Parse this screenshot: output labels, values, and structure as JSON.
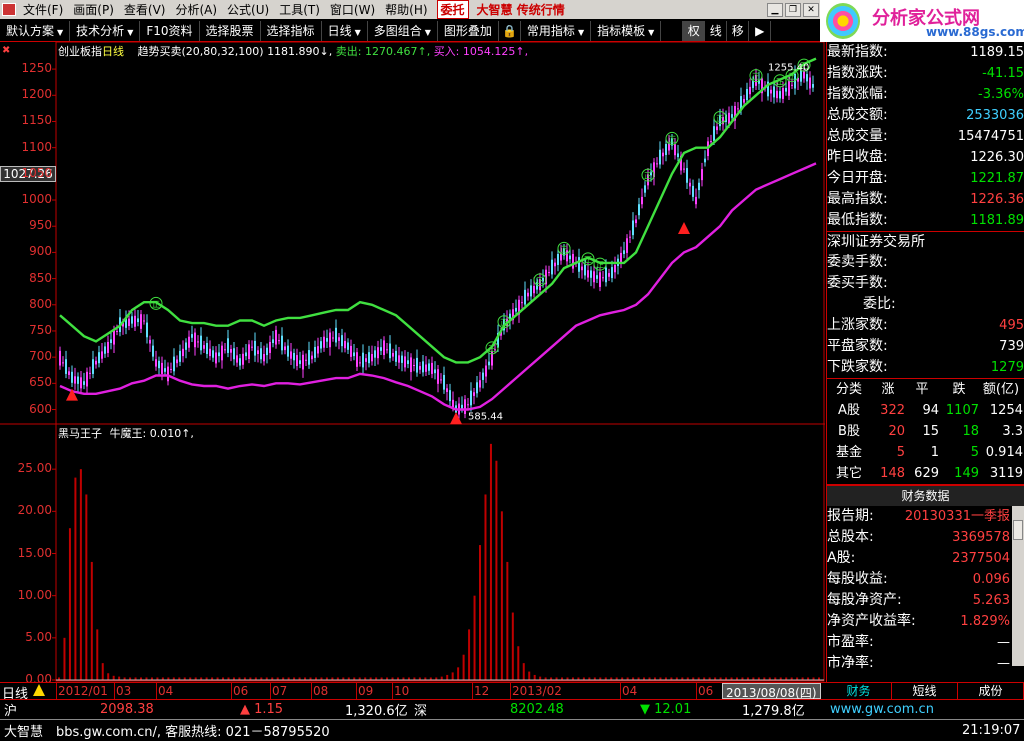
{
  "menu": {
    "items": [
      "文件(F)",
      "画面(P)",
      "查看(V)",
      "分析(A)",
      "公式(U)",
      "工具(T)",
      "窗口(W)",
      "帮助(H)"
    ],
    "trade_button": "委托",
    "brand": "大智慧 传统行情"
  },
  "logo": {
    "title": "分析家公式网",
    "url": "www.88gs.com"
  },
  "toolbar": {
    "items": [
      "默认方案",
      "技术分析",
      "F10资料",
      "选择股票",
      "选择指标",
      "日线",
      "多图组合",
      "图形叠加",
      "常用指标",
      "指标模板"
    ],
    "buttons": [
      "权",
      "线",
      "移"
    ]
  },
  "chart": {
    "title": "创业板指",
    "period_label": "日线",
    "indicator_name": "趋势买卖(20,80,32,100)",
    "indicator_value": "1181.890↓,",
    "sell_label": "卖出:",
    "sell_value": "1270.467↑,",
    "buy_label": "买入:",
    "buy_value": "1054.125↑,",
    "current_price": "1027.26",
    "high_annotation": "1255.40",
    "low_annotation": "585.44",
    "sub_indicator_name": "黑马王子",
    "sub_line": "牛魔王: 0.010↑,",
    "colors": {
      "upper": "#40e040",
      "lower": "#e020e0",
      "up_candle": "#ff40ff",
      "down_candle": "#60e0ff",
      "volume": "#c00000"
    }
  },
  "chart_data": [
    {
      "type": "line",
      "title": "创业板指",
      "y_ticks": [
        600,
        650,
        700,
        750,
        800,
        850,
        900,
        950,
        1000,
        1050,
        1100,
        1150,
        1200,
        1250
      ],
      "ylim": [
        580,
        1275
      ],
      "x_labels": [
        "2012/01",
        "03",
        "04",
        "06",
        "07",
        "08",
        "09",
        "10",
        "12",
        "2013/02",
        "04",
        "06"
      ],
      "series": [
        {
          "name": "卖出",
          "values": [
            780,
            760,
            740,
            730,
            745,
            760,
            790,
            805,
            805,
            790,
            770,
            765,
            765,
            760,
            760,
            770,
            770,
            760,
            770,
            775,
            775,
            780,
            785,
            790,
            790,
            805,
            800,
            790,
            780,
            760,
            740,
            720,
            700,
            690,
            690,
            700,
            720,
            760,
            780,
            800,
            820,
            840,
            870,
            880,
            890,
            880,
            880,
            880,
            900,
            950,
            1000,
            1050,
            1090,
            1100,
            1100,
            1120,
            1150,
            1180,
            1200,
            1220,
            1230,
            1240,
            1260,
            1270
          ]
        },
        {
          "name": "买入",
          "values": [
            645,
            635,
            630,
            630,
            635,
            640,
            650,
            655,
            665,
            665,
            655,
            648,
            645,
            645,
            640,
            645,
            648,
            645,
            650,
            650,
            648,
            652,
            656,
            660,
            660,
            668,
            665,
            660,
            652,
            645,
            635,
            625,
            610,
            600,
            600,
            605,
            620,
            640,
            660,
            680,
            700,
            720,
            740,
            760,
            770,
            780,
            785,
            790,
            800,
            820,
            850,
            880,
            900,
            910,
            930,
            950,
            980,
            1000,
            1020,
            1030,
            1040,
            1050,
            1060,
            1070
          ]
        },
        {
          "name": "收盘",
          "values": [
            700,
            660,
            650,
            690,
            720,
            760,
            770,
            770,
            690,
            670,
            700,
            740,
            720,
            700,
            720,
            690,
            720,
            700,
            740,
            710,
            690,
            700,
            730,
            740,
            720,
            690,
            700,
            720,
            700,
            690,
            680,
            680,
            650,
            600,
            610,
            650,
            700,
            760,
            790,
            820,
            840,
            870,
            900,
            880,
            860,
            850,
            860,
            900,
            960,
            1040,
            1080,
            1110,
            1060,
            1000,
            1100,
            1150,
            1160,
            1190,
            1230,
            1210,
            1200,
            1220,
            1240,
            1210
          ]
        }
      ]
    },
    {
      "type": "bar",
      "title": "黑马王子",
      "y_ticks": [
        0.0,
        5.0,
        10.0,
        15.0,
        20.0,
        25.0
      ],
      "ylim": [
        0,
        30
      ],
      "series": [
        {
          "values": [
            0.3,
            5,
            18,
            24,
            25,
            22,
            14,
            6,
            2,
            0.8,
            0.5,
            0.4,
            0.3,
            0.3,
            0.3,
            0.3,
            0.3,
            0.3,
            0.3,
            0.3,
            0.3,
            0.3,
            0.3,
            0.3,
            0.3,
            0.3,
            0.3,
            0.3,
            0.3,
            0.3,
            0.3,
            0.3,
            0.3,
            0.3,
            0.3,
            0.3,
            0.3,
            0.3,
            0.3,
            0.3,
            0.3,
            0.3,
            0.3,
            0.3,
            0.3,
            0.3,
            0.3,
            0.3,
            0.3,
            0.3,
            0.3,
            0.3,
            0.3,
            0.3,
            0.3,
            0.3,
            0.3,
            0.3,
            0.3,
            0.3,
            0.3,
            0.3,
            0.3,
            0.3,
            0.3,
            0.3,
            0.3,
            0.3,
            0.3,
            0.3,
            0.4,
            0.6,
            0.9,
            1.5,
            3,
            6,
            10,
            16,
            22,
            28,
            26,
            20,
            14,
            8,
            4,
            2,
            1,
            0.6,
            0.4,
            0.3,
            0.3,
            0.3,
            0.3,
            0.3,
            0.3,
            0.3,
            0.3,
            0.3,
            0.3,
            0.3,
            0.3,
            0.3,
            0.3,
            0.3,
            0.3,
            0.3,
            0.3,
            0.3,
            0.3,
            0.3,
            0.3,
            0.3,
            0.3,
            0.3,
            0.3,
            0.3,
            0.3,
            0.3,
            0.3,
            0.3,
            0.3,
            0.3,
            0.3,
            0.3,
            0.3,
            0.3,
            0.3,
            0.3,
            0.3,
            0.3,
            0.3,
            0.3,
            0.3,
            0.3,
            0.3,
            0.3,
            0.3,
            0.3,
            0.3,
            0.3
          ]
        }
      ]
    }
  ],
  "quote": {
    "rows": [
      {
        "label": "最新指数:",
        "value": "1189.15",
        "color": "white"
      },
      {
        "label": "指数涨跌:",
        "value": "-41.15",
        "color": "green"
      },
      {
        "label": "指数涨幅:",
        "value": "-3.36%",
        "color": "green"
      },
      {
        "label": "总成交额:",
        "value": "2533036",
        "color": "cyan"
      },
      {
        "label": "总成交量:",
        "value": "15474751",
        "color": "white"
      },
      {
        "label": "昨日收盘:",
        "value": "1226.30",
        "color": "white"
      },
      {
        "label": "今日开盘:",
        "value": "1221.87",
        "color": "green"
      },
      {
        "label": "最高指数:",
        "value": "1226.36",
        "color": "red"
      },
      {
        "label": "最低指数:",
        "value": "1181.89",
        "color": "green"
      }
    ],
    "exchange_name": "深圳证券交易所",
    "market_rows": [
      {
        "label": "委卖手数:",
        "value": ""
      },
      {
        "label": "委买手数:",
        "value": ""
      },
      {
        "label": "委比:",
        "value": ""
      },
      {
        "label": "上涨家数:",
        "value": "495",
        "color": "red"
      },
      {
        "label": "平盘家数:",
        "value": "739",
        "color": "white"
      },
      {
        "label": "下跌家数:",
        "value": "1279",
        "color": "green"
      }
    ]
  },
  "categories": {
    "headers": [
      "分类",
      "涨",
      "平",
      "跌",
      "额(亿)"
    ],
    "rows": [
      [
        "A股",
        "322",
        "94",
        "1107",
        "1254"
      ],
      [
        "B股",
        "20",
        "15",
        "18",
        "3.3"
      ],
      [
        "基金",
        "5",
        "1",
        "5",
        "0.914"
      ],
      [
        "其它",
        "148",
        "629",
        "149",
        "3119"
      ]
    ]
  },
  "finance": {
    "title": "财务数据",
    "rows": [
      {
        "label": "报告期:",
        "value": "20130331一季报"
      },
      {
        "label": "总股本:",
        "value": "3369578"
      },
      {
        "label": "A股:",
        "value": "2377504"
      },
      {
        "label": "每股收益:",
        "value": "0.096"
      },
      {
        "label": "每股净资产:",
        "value": "5.263"
      },
      {
        "label": "净资产收益率:",
        "value": "1.829%"
      },
      {
        "label": "市盈率:",
        "value": "—"
      },
      {
        "label": "市净率:",
        "value": "—"
      }
    ]
  },
  "bottom_tabs": [
    "财务",
    "短线",
    "成份"
  ],
  "xaxis": {
    "period": "日线",
    "date_box": "2013/08/08(四)"
  },
  "status": {
    "sh_label": "沪",
    "sh_index": "2098.38",
    "sh_change": "▲ 1.15",
    "sh_amount": "1,320.6亿",
    "sz_label": "深",
    "sz_index": "8202.48",
    "sz_change": "▼ 12.01",
    "sz_amount": "1,279.8亿",
    "website": "www.gw.com.cn",
    "brand": "大智慧",
    "hotline": "bbs.gw.com.cn/, 客服热线: 021－58795520",
    "time": "21:19:07"
  }
}
